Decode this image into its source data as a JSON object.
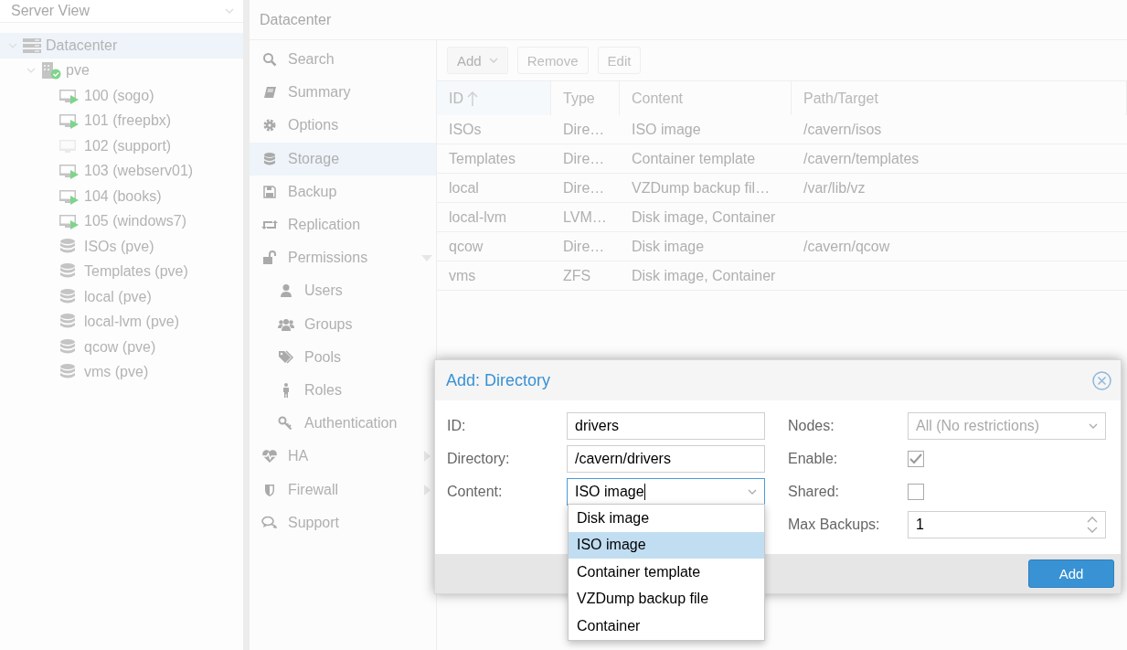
{
  "view_selector": {
    "value": "Server View"
  },
  "tree": [
    {
      "label": "Datacenter",
      "kind": "datacenter",
      "selected": true,
      "expanded": true,
      "children": [
        {
          "label": "pve",
          "kind": "node",
          "selected": false,
          "expanded": true,
          "children": [
            {
              "label": "100 (sogo)",
              "kind": "vm",
              "running": true,
              "selected": false
            },
            {
              "label": "101 (freepbx)",
              "kind": "vm",
              "running": true,
              "selected": false
            },
            {
              "label": "102 (support)",
              "kind": "vm",
              "running": false,
              "selected": false
            },
            {
              "label": "103 (webserv01)",
              "kind": "vm",
              "running": true,
              "selected": false
            },
            {
              "label": "104 (books)",
              "kind": "vm",
              "running": true,
              "selected": false
            },
            {
              "label": "105 (windows7)",
              "kind": "vm",
              "running": true,
              "selected": false
            },
            {
              "label": "ISOs (pve)",
              "kind": "storage",
              "selected": false
            },
            {
              "label": "Templates (pve)",
              "kind": "storage",
              "selected": false
            },
            {
              "label": "local (pve)",
              "kind": "storage",
              "selected": false
            },
            {
              "label": "local-lvm (pve)",
              "kind": "storage",
              "selected": false
            },
            {
              "label": "qcow (pve)",
              "kind": "storage",
              "selected": false
            },
            {
              "label": "vms (pve)",
              "kind": "storage",
              "selected": false
            }
          ]
        }
      ]
    }
  ],
  "header": {
    "title": "Datacenter"
  },
  "nav": [
    {
      "label": "Search",
      "selected": false
    },
    {
      "label": "Summary",
      "selected": false
    },
    {
      "label": "Options",
      "selected": false
    },
    {
      "label": "Storage",
      "selected": true
    },
    {
      "label": "Backup",
      "selected": false
    },
    {
      "label": "Replication",
      "selected": false
    },
    {
      "label": "Permissions",
      "selected": false,
      "expanded": true,
      "children": [
        {
          "label": "Users",
          "selected": false
        },
        {
          "label": "Groups",
          "selected": false
        },
        {
          "label": "Pools",
          "selected": false
        },
        {
          "label": "Roles",
          "selected": false
        },
        {
          "label": "Authentication",
          "selected": false
        }
      ]
    },
    {
      "label": "HA",
      "selected": false,
      "expanded": false
    },
    {
      "label": "Firewall",
      "selected": false,
      "expanded": false
    },
    {
      "label": "Support",
      "selected": false
    }
  ],
  "toolbar": [
    {
      "label": "Add",
      "kind": "menu",
      "disabled": false
    },
    {
      "label": "Remove",
      "kind": "plain",
      "disabled": true
    },
    {
      "label": "Edit",
      "kind": "plain",
      "disabled": true
    }
  ],
  "table": {
    "columns": [
      {
        "label": "ID",
        "sorted": true
      },
      {
        "label": "Type",
        "sorted": false
      },
      {
        "label": "Content",
        "sorted": false
      },
      {
        "label": "Path/Target",
        "sorted": false
      }
    ],
    "rows": [
      [
        "ISOs",
        "Dire…",
        "ISO image",
        "/cavern/isos"
      ],
      [
        "Templates",
        "Dire…",
        "Container template",
        "/cavern/templates"
      ],
      [
        "local",
        "Dire…",
        "VZDump backup fil…",
        "/var/lib/vz"
      ],
      [
        "local-lvm",
        "LVM…",
        "Disk image, Container",
        ""
      ],
      [
        "qcow",
        "Dire…",
        "Disk image",
        "/cavern/qcow"
      ],
      [
        "vms",
        "ZFS",
        "Disk image, Container",
        ""
      ]
    ]
  },
  "dialog": {
    "title": "Add: Directory",
    "left_fields": [
      {
        "label": "ID:",
        "kind": "text",
        "value": "drivers",
        "focused": false
      },
      {
        "label": "Directory:",
        "kind": "text",
        "value": "/cavern/drivers",
        "focused": false
      },
      {
        "label": "Content:",
        "kind": "combo",
        "value": "ISO image",
        "focused": true
      }
    ],
    "right_fields": [
      {
        "label": "Nodes:",
        "kind": "combo",
        "placeholder": "All (No restrictions)"
      },
      {
        "label": "Enable:",
        "kind": "checkbox",
        "checked": true
      },
      {
        "label": "Shared:",
        "kind": "checkbox",
        "checked": false
      },
      {
        "label": "Max Backups:",
        "kind": "spinner",
        "value": "1"
      }
    ],
    "dropdown": [
      {
        "label": "Disk image",
        "selected": false
      },
      {
        "label": "ISO image",
        "selected": true
      },
      {
        "label": "Container template",
        "selected": false
      },
      {
        "label": "VZDump backup file",
        "selected": false
      },
      {
        "label": "Container",
        "selected": false
      }
    ],
    "button": "Add"
  }
}
